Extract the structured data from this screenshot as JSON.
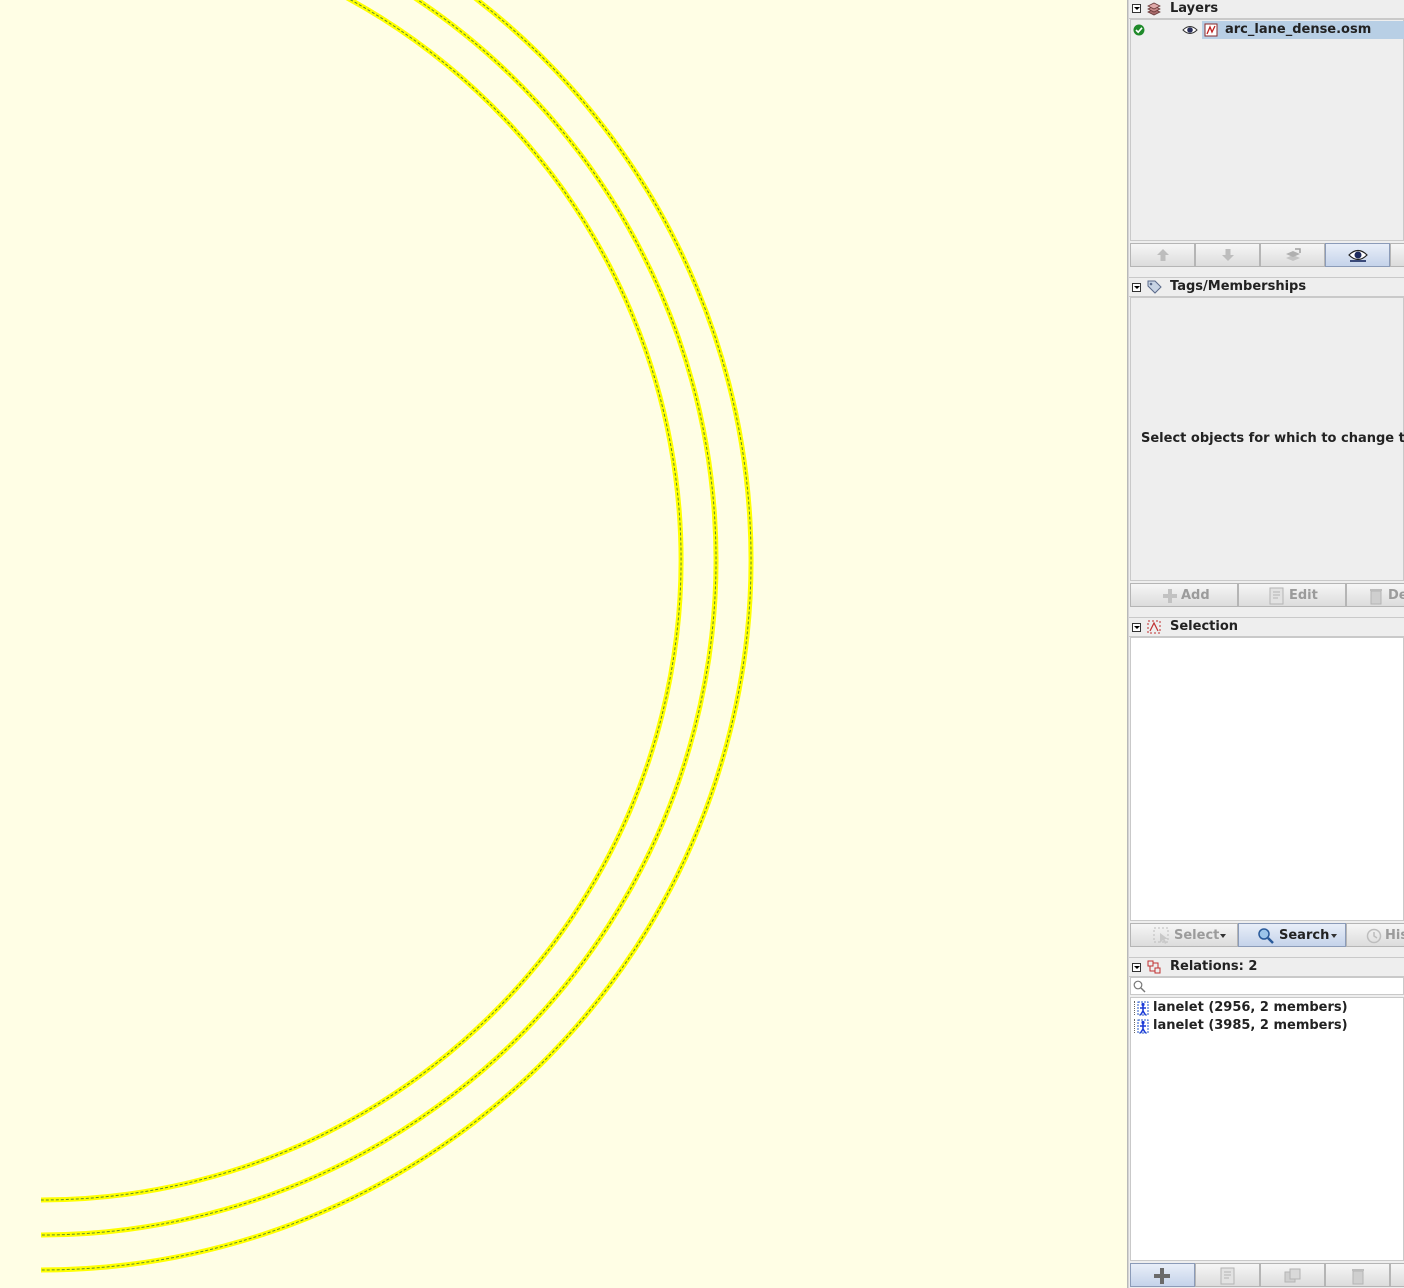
{
  "colors": {
    "map_background": "#fffee5",
    "way_highlight": "#ffff00",
    "way_core": "#5a8a30",
    "panel_background": "#eeeeee",
    "selected_row": "#b8cfe5"
  },
  "map": {
    "lanes": [
      {
        "name": "lane-boundary-inner"
      },
      {
        "name": "lane-boundary-middle"
      },
      {
        "name": "lane-boundary-outer"
      }
    ]
  },
  "layers": {
    "title": "Layers",
    "items": [
      {
        "name": "arc_lane_dense.osm",
        "active": true,
        "visible": true
      }
    ],
    "buttons": [
      {
        "icon": "move-up-icon"
      },
      {
        "icon": "move-down-icon"
      },
      {
        "icon": "merge-icon"
      },
      {
        "icon": "visibility-toggle-icon"
      }
    ]
  },
  "tags": {
    "title": "Tags/Memberships",
    "empty_message": "Select objects for which to change ta",
    "buttons": [
      {
        "label": "Add",
        "icon": "add-icon"
      },
      {
        "label": "Edit",
        "icon": "edit-icon"
      },
      {
        "label": "De",
        "icon": "delete-icon"
      }
    ]
  },
  "selection": {
    "title": "Selection",
    "buttons": [
      {
        "label": "Select",
        "icon": "select-icon"
      },
      {
        "label": "Search",
        "icon": "search-icon"
      },
      {
        "label": "His",
        "icon": "history-icon"
      }
    ]
  },
  "relations": {
    "title": "Relations: 2",
    "filter_placeholder": "",
    "items": [
      {
        "label": "lanelet (2956, 2 members)"
      },
      {
        "label": "lanelet (3985, 2 members)"
      }
    ],
    "buttons": [
      {
        "icon": "new-relation-icon"
      },
      {
        "icon": "edit-relation-icon"
      },
      {
        "icon": "duplicate-relation-icon"
      },
      {
        "icon": "delete-relation-icon"
      }
    ]
  }
}
